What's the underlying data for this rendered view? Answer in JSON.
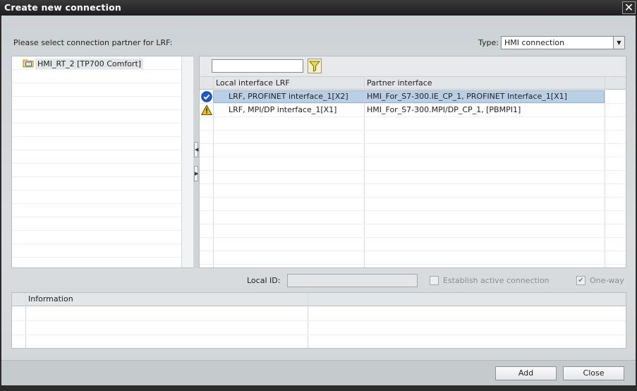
{
  "window": {
    "title": "Create new connection"
  },
  "prompt": "Please select connection partner for LRF:",
  "type": {
    "label": "Type:",
    "value": "HMI connection"
  },
  "tree": {
    "items": [
      {
        "label": "HMI_RT_2 [TP700 Comfort]"
      }
    ]
  },
  "grid": {
    "columns": [
      "Local interface LRF",
      "Partner interface"
    ],
    "rows": [
      {
        "status": "ok",
        "local": "LRF, PROFINET interface_1[X2]",
        "partner": "HMI_For_S7-300.IE_CP_1, PROFINET Interface_1[X1]",
        "selected": true
      },
      {
        "status": "warning",
        "local": "LRF, MPI/DP interface_1[X1]",
        "partner": "HMI_For_S7-300.MPI/DP_CP_1, [PBMPI1]",
        "selected": false
      }
    ]
  },
  "local_id": {
    "label": "Local ID:",
    "value": ""
  },
  "options": {
    "establish_active": {
      "label": "Establish active connection",
      "checked": false
    },
    "one_way": {
      "label": "One-way",
      "checked": true
    }
  },
  "info": {
    "columns": [
      "Information",
      ""
    ]
  },
  "buttons": {
    "add": "Add",
    "close": "Close"
  },
  "colors": {
    "selection": "#b9cfe6",
    "titlebar": "#1e1e1e",
    "ok": "#1a5bd1",
    "warning": "#f2c40f"
  }
}
